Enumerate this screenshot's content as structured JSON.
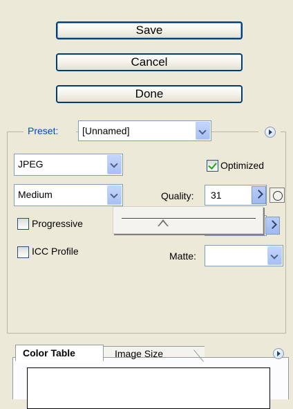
{
  "buttons": {
    "save": "Save",
    "cancel": "Cancel",
    "done": "Done"
  },
  "preset": {
    "label": "Preset:",
    "value": "[Unnamed]"
  },
  "format": {
    "value": "JPEG"
  },
  "quality_preset": {
    "value": "Medium"
  },
  "optimized": {
    "label": "Optimized",
    "checked": true
  },
  "quality": {
    "label": "Quality:",
    "value": "31"
  },
  "progressive": {
    "label": "Progressive",
    "checked": false
  },
  "icc_profile": {
    "label": "ICC Profile",
    "checked": false
  },
  "matte": {
    "label": "Matte:",
    "value": ""
  },
  "tabs": {
    "color_table": "Color Table",
    "image_size": "Image Size"
  },
  "colors": {
    "accent": "#003c74",
    "preset_label": "#0046d5",
    "panel_bg": "#ece9d8"
  }
}
